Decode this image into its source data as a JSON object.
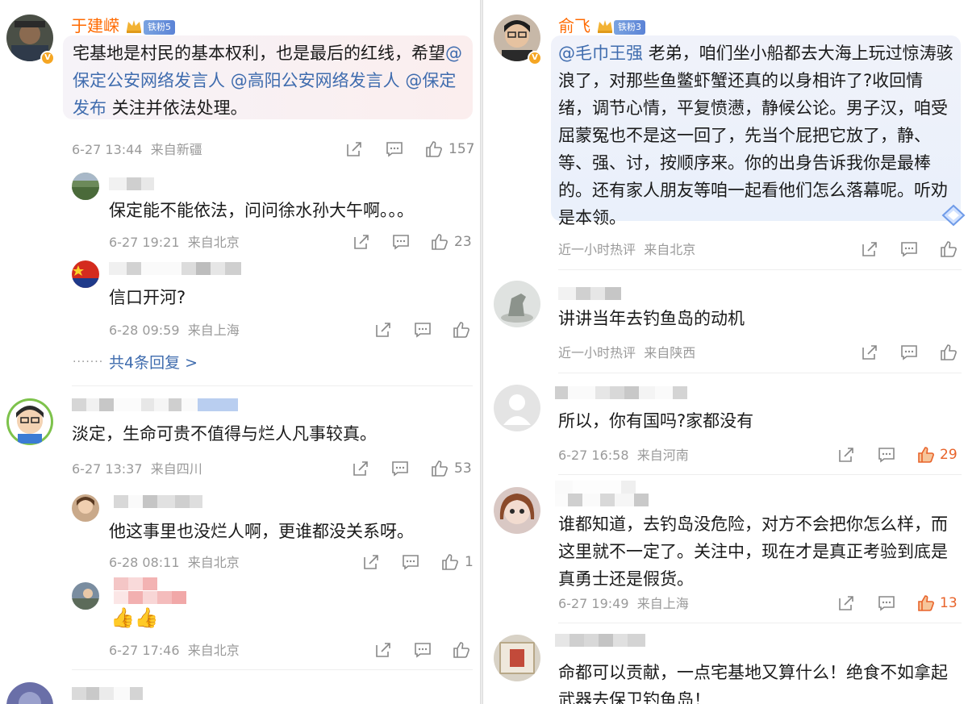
{
  "left": {
    "top_comment": {
      "username": "于建嵘",
      "fan_badge": "铁粉5",
      "verify_badge": "V",
      "text_prefix": "宅基地是村民的基本权利，也是最后的红线，希望",
      "mentions": [
        "@保定公安网络发言人",
        "@高阳公安网络发言人",
        "@保定发布"
      ],
      "text_suffix": "关注并依法处理。",
      "time": "6-27 13:44",
      "location": "来自新疆",
      "likes": "157"
    },
    "replies_1": [
      {
        "text": "保定能不能依法，问问徐水孙大午啊。。。",
        "time": "6-27 19:21",
        "location": "来自北京",
        "likes": "23"
      },
      {
        "text": "信口开河?",
        "time": "6-28 09:59",
        "location": "来自上海",
        "likes": ""
      }
    ],
    "more_replies": "共4条回复 >",
    "second_comment": {
      "text": "淡定，生命可贵不值得与烂人凡事较真。",
      "time": "6-27 13:37",
      "location": "来自四川",
      "likes": "53"
    },
    "replies_2": [
      {
        "text": "他这事里也没烂人啊，更谁都没关系呀。",
        "time": "6-28 08:11",
        "location": "来自北京",
        "likes": "1"
      },
      {
        "text": "",
        "time": "6-27 17:46",
        "location": "来自北京",
        "likes": ""
      }
    ]
  },
  "right": {
    "top_comment": {
      "username": "俞飞",
      "fan_badge": "铁粉3",
      "verify_badge": "V",
      "mention": "@毛巾王强",
      "text": "老弟，咱们坐小船都去大海上玩过惊涛骇浪了，对那些鱼鳖虾蟹还真的以身相许了?收回情绪，调节心情，平复愤懑，静候公论。男子汉，咱受屈蒙冤也不是这一回了，先当个屁把它放了，静、等、强、讨，按顺序来。你的出身告诉我你是最棒的。还有家人朋友等咱一起看他们怎么落幕呢。听劝是本领。",
      "time": "近一小时热评",
      "location": "来自北京",
      "likes": ""
    },
    "comments": [
      {
        "text": "讲讲当年去钓鱼岛的动机",
        "time": "近一小时热评",
        "location": "来自陕西",
        "likes": ""
      },
      {
        "text": "所以，你有国吗?家都没有",
        "time": "6-27 16:58",
        "location": "来自河南",
        "likes": "29"
      },
      {
        "text": "谁都知道，去钓岛没危险，对方不会把你怎么样，而这里就不一定了。关注中，现在才是真正考验到底是真勇士还是假货。",
        "time": "6-27 19:49",
        "location": "来自上海",
        "likes": "13"
      },
      {
        "text": "命都可以贡献，一点宅基地又算什么！绝食不如拿起武器去保卫钓鱼岛！",
        "time": "",
        "location": "",
        "likes": ""
      }
    ]
  },
  "colors": {
    "username": "#ff6a00",
    "mention": "#3f6cae",
    "hot_like": "#e8632a",
    "meta": "#9a9a9a"
  },
  "icons": [
    "share-icon",
    "comment-icon",
    "like-icon",
    "crown-icon",
    "verified-badge-icon"
  ]
}
